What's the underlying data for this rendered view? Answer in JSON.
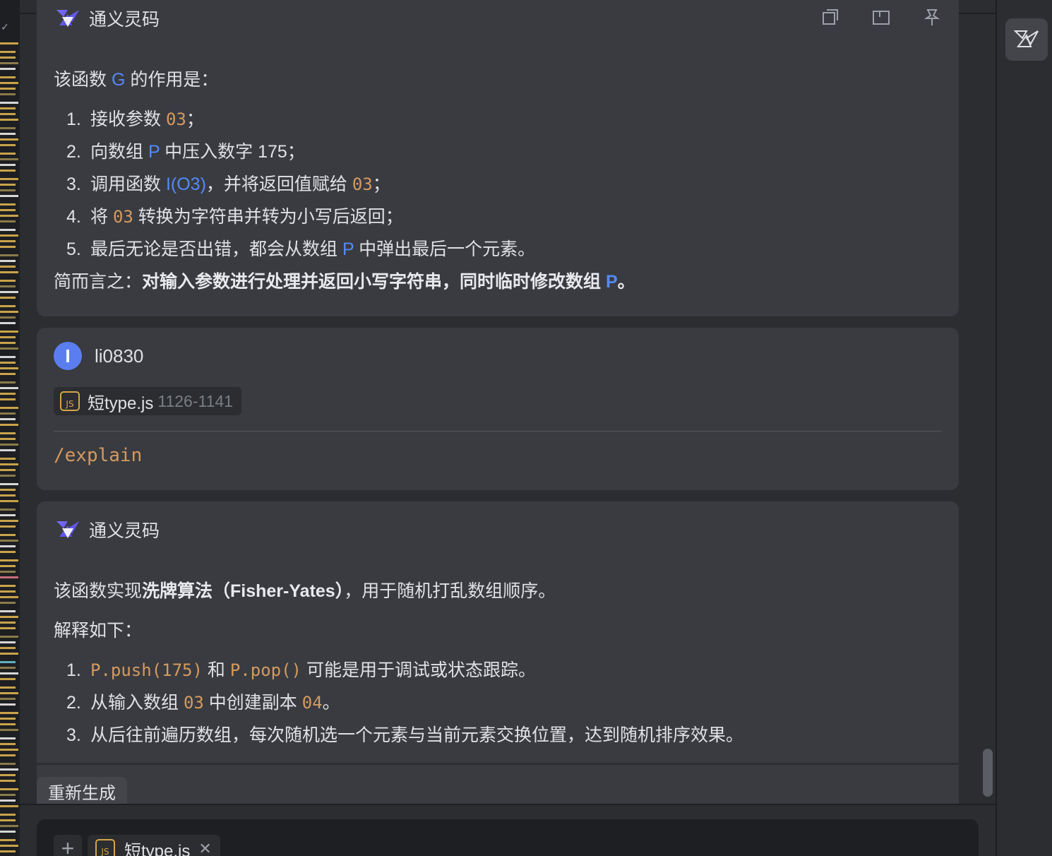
{
  "assistant": {
    "name": "通义灵码"
  },
  "response1": {
    "intro_pre": "该函数 ",
    "intro_fn": "G",
    "intro_post": " 的作用是：",
    "items": [
      {
        "num": "1.",
        "parts": [
          {
            "t": "接收参数 "
          },
          {
            "t": "03",
            "c": "orange"
          },
          {
            "t": "；"
          }
        ]
      },
      {
        "num": "2.",
        "parts": [
          {
            "t": "向数组 "
          },
          {
            "t": "P",
            "c": "blue"
          },
          {
            "t": " 中压入数字 175；"
          }
        ]
      },
      {
        "num": "3.",
        "parts": [
          {
            "t": "调用函数 "
          },
          {
            "t": "I(O3)",
            "c": "blue"
          },
          {
            "t": "，并将返回值赋给 "
          },
          {
            "t": "03",
            "c": "orange"
          },
          {
            "t": "；"
          }
        ]
      },
      {
        "num": "4.",
        "parts": [
          {
            "t": "将 "
          },
          {
            "t": "03",
            "c": "orange"
          },
          {
            "t": " 转换为字符串并转为小写后返回；"
          }
        ]
      },
      {
        "num": "5.",
        "parts": [
          {
            "t": "最后无论是否出错，都会从数组 "
          },
          {
            "t": "P",
            "c": "blue"
          },
          {
            "t": " 中弹出最后一个元素。"
          }
        ]
      }
    ],
    "summary_pre": "简而言之：",
    "summary_bold": "对输入参数进行处理并返回小写字符串，同时临时修改数组 ",
    "summary_p": "P",
    "summary_end": "。"
  },
  "user": {
    "avatar_letter": "I",
    "name": "li0830",
    "file_name": "短type.js",
    "file_range": "1126-1141",
    "command": "/explain"
  },
  "response2": {
    "intro_pre": "该函数实现",
    "intro_bold": "洗牌算法（Fisher-Yates）",
    "intro_post": "，用于随机打乱数组顺序。",
    "explain": "解释如下：",
    "items": [
      {
        "num": "1.",
        "parts": [
          {
            "t": "P.push(175)",
            "c": "code"
          },
          {
            "t": " 和 "
          },
          {
            "t": "P.pop()",
            "c": "code"
          },
          {
            "t": " 可能是用于调试或状态跟踪。"
          }
        ]
      },
      {
        "num": "2.",
        "parts": [
          {
            "t": "从输入数组 "
          },
          {
            "t": "03",
            "c": "orange"
          },
          {
            "t": " 中创建副本 "
          },
          {
            "t": "04",
            "c": "orange"
          },
          {
            "t": "。"
          }
        ]
      },
      {
        "num": "3.",
        "parts": [
          {
            "t": "从后往前遍历数组，每次随机选一个元素与当前元素交换位置，达到随机排序效果。"
          }
        ]
      }
    ]
  },
  "actions": {
    "regenerate": "重新生成"
  },
  "input": {
    "add_label": "+",
    "file_name": "短type.js",
    "close_label": "✕"
  },
  "colors": {
    "accent": "#3574f0",
    "code_orange": "#d59a5f",
    "symbol_blue": "#548af7",
    "card_bg": "#393b40",
    "panel_bg": "#2b2d30"
  }
}
